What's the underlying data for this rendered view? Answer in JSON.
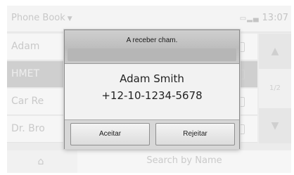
{
  "background": {
    "title": "Phone Book",
    "status": {
      "time": "13:07"
    },
    "contacts": [
      {
        "name": "Adam"
      },
      {
        "name": "HMET",
        "selected": true
      },
      {
        "name": "Car Re"
      },
      {
        "name": "Dr. Bro"
      }
    ],
    "page_indicator": "1/2",
    "search_label": "Search by Name"
  },
  "dialog": {
    "title": "A receber cham.",
    "caller_name": "Adam Smith",
    "caller_number": "+12-10-1234-5678",
    "accept_label": "Aceitar",
    "reject_label": "Rejeitar"
  }
}
